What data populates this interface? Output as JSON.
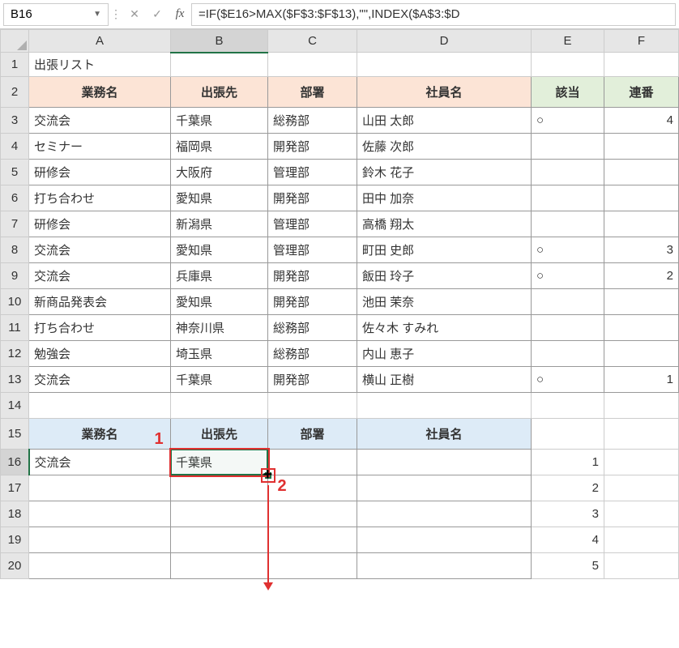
{
  "nameBox": "B16",
  "formula": "=IF($E16>MAX($F$3:$F$13),\"\",INDEX($A$3:$D",
  "columns": [
    "A",
    "B",
    "C",
    "D",
    "E",
    "F"
  ],
  "selectedCol": "B",
  "selectedRow": 16,
  "title": "出張リスト",
  "headers1": {
    "A": "業務名",
    "B": "出張先",
    "C": "部署",
    "D": "社員名",
    "E": "該当",
    "F": "連番"
  },
  "rows": [
    {
      "r": 3,
      "A": "交流会",
      "B": "千葉県",
      "C": "総務部",
      "D": "山田 太郎",
      "E": "○",
      "F": "4"
    },
    {
      "r": 4,
      "A": "セミナー",
      "B": "福岡県",
      "C": "開発部",
      "D": "佐藤 次郎",
      "E": "",
      "F": ""
    },
    {
      "r": 5,
      "A": "研修会",
      "B": "大阪府",
      "C": "管理部",
      "D": "鈴木 花子",
      "E": "",
      "F": ""
    },
    {
      "r": 6,
      "A": "打ち合わせ",
      "B": "愛知県",
      "C": "開発部",
      "D": "田中 加奈",
      "E": "",
      "F": ""
    },
    {
      "r": 7,
      "A": "研修会",
      "B": "新潟県",
      "C": "管理部",
      "D": "高橋 翔太",
      "E": "",
      "F": ""
    },
    {
      "r": 8,
      "A": "交流会",
      "B": "愛知県",
      "C": "管理部",
      "D": "町田 史郎",
      "E": "○",
      "F": "3"
    },
    {
      "r": 9,
      "A": "交流会",
      "B": "兵庫県",
      "C": "開発部",
      "D": "飯田 玲子",
      "E": "○",
      "F": "2"
    },
    {
      "r": 10,
      "A": "新商品発表会",
      "B": "愛知県",
      "C": "開発部",
      "D": "池田 茉奈",
      "E": "",
      "F": ""
    },
    {
      "r": 11,
      "A": "打ち合わせ",
      "B": "神奈川県",
      "C": "総務部",
      "D": "佐々木 すみれ",
      "E": "",
      "F": ""
    },
    {
      "r": 12,
      "A": "勉強会",
      "B": "埼玉県",
      "C": "総務部",
      "D": "内山 恵子",
      "E": "",
      "F": ""
    },
    {
      "r": 13,
      "A": "交流会",
      "B": "千葉県",
      "C": "開発部",
      "D": "横山 正樹",
      "E": "○",
      "F": "1"
    }
  ],
  "row14": {
    "r": 14
  },
  "headers2": {
    "A": "業務名",
    "B": "出張先",
    "C": "部署",
    "D": "社員名"
  },
  "rows2": [
    {
      "r": 16,
      "A": "交流会",
      "B": "千葉県",
      "C": "",
      "D": "",
      "E": "1",
      "F": ""
    },
    {
      "r": 17,
      "A": "",
      "B": "",
      "C": "",
      "D": "",
      "E": "2",
      "F": ""
    },
    {
      "r": 18,
      "A": "",
      "B": "",
      "C": "",
      "D": "",
      "E": "3",
      "F": ""
    },
    {
      "r": 19,
      "A": "",
      "B": "",
      "C": "",
      "D": "",
      "E": "4",
      "F": ""
    },
    {
      "r": 20,
      "A": "",
      "B": "",
      "C": "",
      "D": "",
      "E": "5",
      "F": ""
    }
  ],
  "anno": {
    "label1": "1",
    "label2": "2"
  }
}
